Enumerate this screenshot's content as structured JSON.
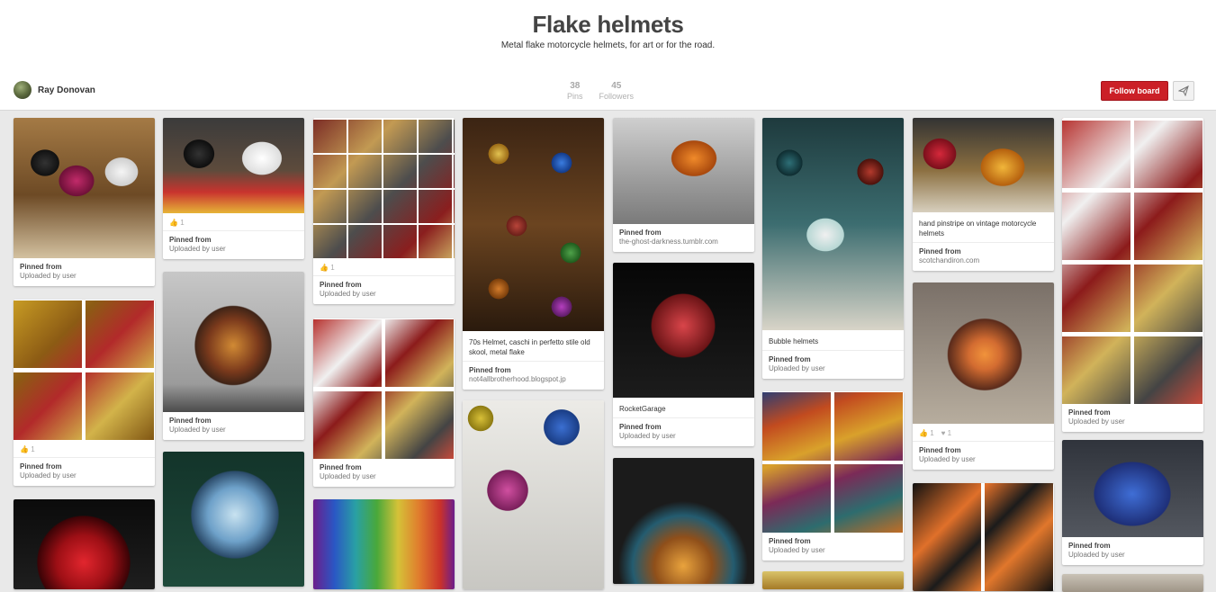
{
  "board": {
    "title": "Flake helmets",
    "description": "Metal flake motorcycle helmets, for art or for the road."
  },
  "owner": {
    "name": "Ray Donovan"
  },
  "stats": {
    "pins_count": "38",
    "pins_label": "Pins",
    "followers_count": "45",
    "followers_label": "Followers"
  },
  "actions": {
    "follow_label": "Follow board",
    "send_icon": "send-icon"
  },
  "pins": [
    {
      "source_title": "Pinned from",
      "source": "Uploaded by user"
    },
    {
      "likes": "1",
      "source_title": "Pinned from",
      "source": "Uploaded by user"
    },
    {
      "likes": "1",
      "source_title": "Pinned from",
      "source": "Uploaded by user"
    },
    {
      "description": "70s Helmet, caschi in perfetto stile old skool, metal flake",
      "source_title": "Pinned from",
      "source": "not4allbrotherhood.blogspot.jp"
    },
    {
      "source_title": "Pinned from",
      "source": "the-ghost-darkness.tumblr.com"
    },
    {
      "description": "Bubble helmets",
      "source_title": "Pinned from",
      "source": "Uploaded by user"
    },
    {
      "description": "hand pinstripe on vintage motorcycle helmets",
      "source_title": "Pinned from",
      "source": "scotchandiron.com"
    },
    {
      "source_title": "Pinned from",
      "source": "Uploaded by user"
    },
    {
      "likes": "1",
      "source_title": "Pinned from",
      "source": "Uploaded by user"
    },
    {
      "source_title": "Pinned from",
      "source": "Uploaded by user"
    },
    {
      "source_title": "Pinned from",
      "source": "Uploaded by user"
    },
    {
      "description": "RocketGarage",
      "source_title": "Pinned from",
      "source": "Uploaded by user"
    },
    {
      "likes": "1",
      "repins": "1",
      "source_title": "Pinned from",
      "source": "Uploaded by user"
    },
    {
      "source_title": "Pinned from",
      "source": "Uploaded by user"
    },
    {
      "source_title": "Pinned from",
      "source": "Uploaded by user"
    }
  ]
}
